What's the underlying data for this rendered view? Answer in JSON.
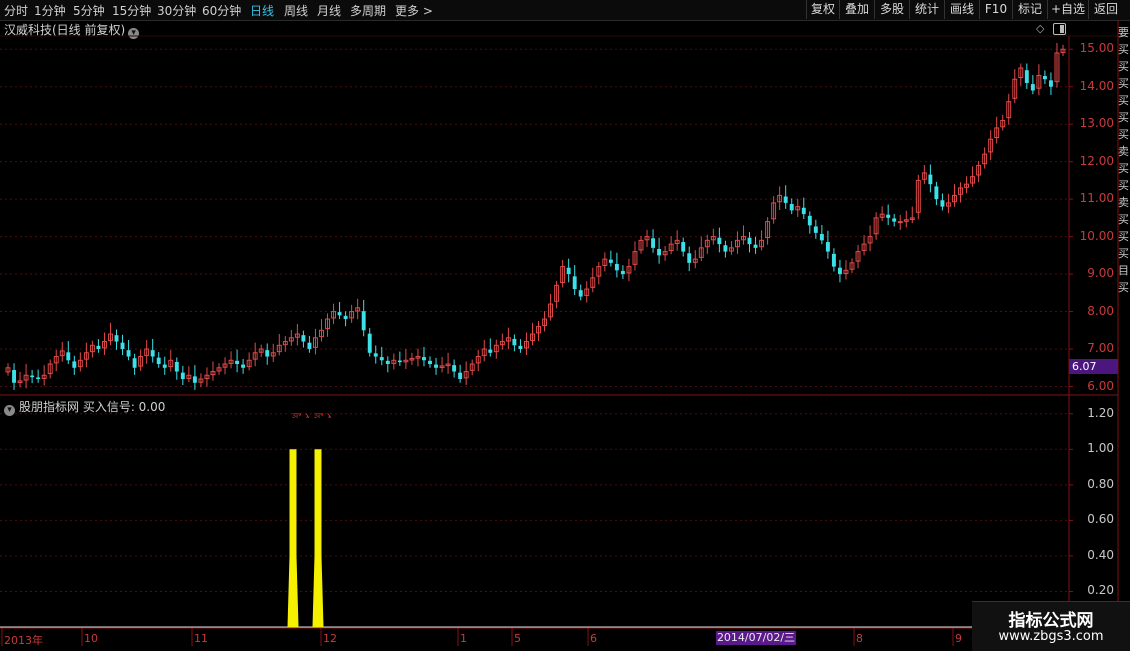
{
  "toolbar": {
    "periods": [
      {
        "label": "分时",
        "active": false
      },
      {
        "label": "1分钟",
        "active": false
      },
      {
        "label": "5分钟",
        "active": false
      },
      {
        "label": "15分钟",
        "active": false
      },
      {
        "label": "30分钟",
        "active": false
      },
      {
        "label": "60分钟",
        "active": false
      },
      {
        "label": "日线",
        "active": true
      },
      {
        "label": "周线",
        "active": false
      },
      {
        "label": "月线",
        "active": false
      },
      {
        "label": "多周期",
        "active": false
      },
      {
        "label": "更多",
        "active": false
      }
    ],
    "more_arrow": ">",
    "right_buttons": [
      "复权",
      "叠加",
      "多股",
      "统计",
      "画线",
      "F10",
      "标记",
      "+自选",
      "返回"
    ]
  },
  "chart_title": "汉威科技(日线 前复权)",
  "chart_title_icon": "chevron-down-icon",
  "main_panel_icons": [
    "diamond-icon",
    "panel-toggle-icon"
  ],
  "current_price_label": "6.07",
  "indicator_title": "股朋指标网 买入信号: 0.00",
  "indicator_signal_text": "买入买入",
  "selected_date": "2014/07/02/三",
  "x_axis_labels": [
    "2013年",
    "10",
    "11",
    "12",
    "1",
    "5",
    "6",
    "8",
    "9"
  ],
  "watermark": {
    "line1": "指标公式网",
    "line2": "www.zbgs3.com"
  },
  "right_side_chars": "要买买买买买买卖买买卖买买买目买",
  "colors": {
    "up": "#e04a4a",
    "down": "#3ce0e8",
    "signal": "#f5f000",
    "grid": "#4a0f0f",
    "axis": "#8a1010",
    "accent": "#35c3e6",
    "price_tag": "#4b177f"
  },
  "chart_data": [
    {
      "type": "candlestick",
      "title": "汉威科技(日线 前复权)",
      "ylim": [
        5.8,
        15.3
      ],
      "y_ticks": [
        "6.00",
        "7.00",
        "8.00",
        "9.00",
        "10.00",
        "11.00",
        "12.00",
        "13.00",
        "14.00",
        "15.00"
      ],
      "x_labels": [
        "2013年",
        "10",
        "11",
        "12",
        "1",
        "5",
        "6",
        "8",
        "9"
      ],
      "ohlc_close": [
        6.5,
        6.1,
        6.15,
        6.3,
        6.25,
        6.2,
        6.3,
        6.6,
        6.8,
        6.95,
        6.7,
        6.5,
        6.7,
        6.9,
        7.1,
        7.0,
        7.2,
        7.4,
        7.2,
        7.0,
        6.8,
        6.5,
        6.8,
        7.0,
        6.8,
        6.6,
        6.5,
        6.7,
        6.4,
        6.2,
        6.3,
        6.1,
        6.2,
        6.3,
        6.4,
        6.5,
        6.6,
        6.7,
        6.6,
        6.5,
        6.7,
        6.9,
        7.0,
        6.8,
        6.9,
        7.1,
        7.2,
        7.3,
        7.4,
        7.2,
        7.0,
        7.3,
        7.5,
        7.8,
        8.0,
        7.9,
        7.8,
        8.0,
        8.1,
        7.5,
        6.9,
        6.8,
        6.7,
        6.6,
        6.7,
        6.65,
        6.7,
        6.75,
        6.8,
        6.7,
        6.6,
        6.5,
        6.55,
        6.6,
        6.4,
        6.2,
        6.4,
        6.6,
        6.8,
        7.0,
        6.9,
        7.1,
        7.2,
        7.3,
        7.1,
        7.0,
        7.2,
        7.4,
        7.6,
        7.8,
        8.2,
        8.7,
        9.2,
        9.0,
        8.6,
        8.4,
        8.6,
        8.9,
        9.2,
        9.4,
        9.3,
        9.1,
        9.0,
        9.2,
        9.6,
        9.9,
        10.0,
        9.7,
        9.5,
        9.6,
        9.8,
        9.9,
        9.6,
        9.3,
        9.4,
        9.7,
        9.9,
        10.0,
        9.8,
        9.6,
        9.7,
        9.9,
        10.0,
        9.8,
        9.7,
        9.9,
        10.4,
        10.9,
        11.1,
        10.9,
        10.7,
        10.8,
        10.6,
        10.3,
        10.1,
        9.9,
        9.6,
        9.2,
        9.0,
        9.1,
        9.3,
        9.6,
        9.8,
        10.0,
        10.5,
        10.6,
        10.5,
        10.4,
        10.4,
        10.45,
        10.5,
        11.5,
        11.7,
        11.4,
        11.0,
        10.8,
        10.9,
        11.1,
        11.3,
        11.4,
        11.6,
        11.9,
        12.2,
        12.6,
        12.9,
        13.1,
        13.6,
        14.2,
        14.5,
        14.1,
        13.9,
        14.3,
        14.2,
        14.0,
        14.9,
        15.0
      ],
      "current_price": 6.07
    },
    {
      "type": "bar",
      "title": "股朋指标网 买入信号: 0.00",
      "series": [
        {
          "name": "买入信号",
          "values": [
            1,
            1
          ]
        }
      ],
      "categories": [
        "12",
        "12"
      ],
      "current_value": 0.0,
      "ylim": [
        0,
        1.3
      ],
      "y_ticks": [
        "0.20",
        "0.40",
        "0.60",
        "0.80",
        "1.00",
        "1.20"
      ],
      "annotation": "买入买入"
    }
  ]
}
